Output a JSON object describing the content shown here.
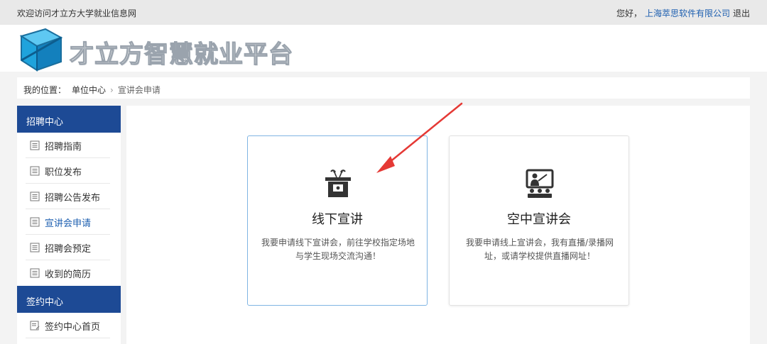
{
  "topbar": {
    "welcome": "欢迎访问才立方大学就业信息网",
    "greeting": "您好，",
    "company": "上海萃思软件有限公司",
    "logout": "退出"
  },
  "header": {
    "logo_text": "才立方智慧就业平台",
    "logo_icon": "cube-logo-icon"
  },
  "breadcrumb": {
    "label": "我的位置：",
    "parent": "单位中心",
    "separator": "›",
    "current": "宣讲会申请"
  },
  "sidebar": {
    "sections": [
      {
        "title": "招聘中心",
        "items": [
          {
            "label": "招聘指南"
          },
          {
            "label": "职位发布"
          },
          {
            "label": "招聘公告发布"
          },
          {
            "label": "宣讲会申请",
            "active": true
          },
          {
            "label": "招聘会预定"
          },
          {
            "label": "收到的简历"
          }
        ]
      },
      {
        "title": "签约中心",
        "items": [
          {
            "label": "签约中心首页"
          }
        ]
      }
    ]
  },
  "cards": [
    {
      "title": "线下宣讲",
      "description": "我要申请线下宣讲会，前往学校指定场地与学生现场交流沟通！",
      "icon": "podium-icon"
    },
    {
      "title": "空中宣讲会",
      "description": "我要申请线上宣讲会，我有直播/录播网址，或请学校提供直播网址！",
      "icon": "online-lecture-icon"
    }
  ],
  "colors": {
    "primary": "#1d4a95",
    "link": "#1d5fb0",
    "card_highlight": "#7fb4e3",
    "annotation_arrow": "#e53935"
  }
}
